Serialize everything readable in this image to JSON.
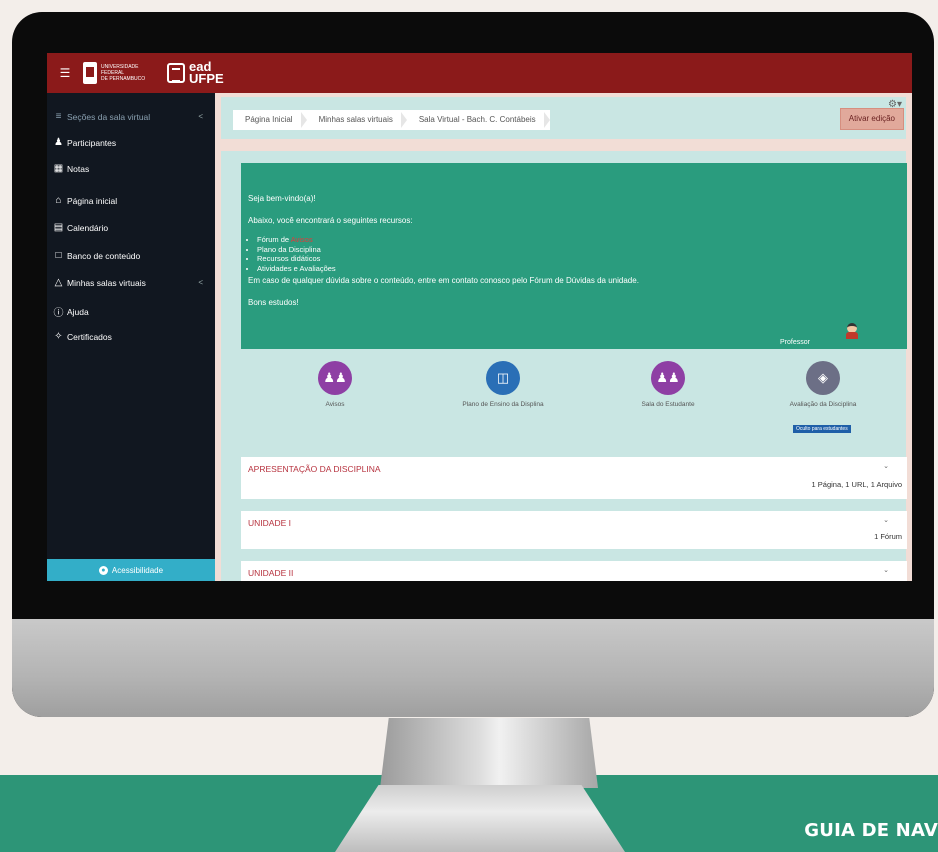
{
  "topbar": {
    "menu_icon": "hamburger-icon",
    "univ_text": [
      "UNIVERSIDADE",
      "FEDERAL",
      "DE PERNAMBUCO"
    ],
    "ead": "ead",
    "ufpe": "UFPE"
  },
  "sidebar": {
    "items": [
      {
        "icon": "list-icon",
        "label": "Seções da sala virtual",
        "chevron": true,
        "dim": true
      },
      {
        "icon": "participants-icon",
        "label": "Participantes"
      },
      {
        "icon": "grades-icon",
        "label": "Notas"
      },
      {
        "icon": "home-icon",
        "label": "Página inicial"
      },
      {
        "icon": "calendar-icon",
        "label": "Calendário"
      },
      {
        "icon": "file-icon",
        "label": "Banco de conteúdo"
      },
      {
        "icon": "graduation-cap-icon",
        "label": "Minhas salas virtuais",
        "chevron": true
      },
      {
        "icon": "help-icon",
        "label": "Ajuda"
      },
      {
        "icon": "certificate-icon",
        "label": "Certificados"
      }
    ],
    "accessibility": "Acessibilidade"
  },
  "header": {
    "breadcrumbs": [
      "Página Inicial",
      "Minhas salas virtuais",
      "Sala Virtual - Bach. C. Contábeis"
    ],
    "edit_button": "Ativar edição"
  },
  "welcome": {
    "greeting": "Seja bem-vindo(a)!",
    "intro": "Abaixo, você encontrará o seguintes recursos:",
    "bullets": [
      {
        "text": "Fórum de ",
        "highlight": "Avisos"
      },
      {
        "text": "Plano da Disciplina"
      },
      {
        "text": "Recursos didáticos"
      },
      {
        "text": "Atividades e Avaliações"
      }
    ],
    "contact": "Em caso de qualquer dúvida sobre o conteúdo, entre em contato conosco pelo Fórum de Dúvidas da unidade.",
    "closing": "Bons estudos!",
    "professor": "Professor"
  },
  "tiles": [
    {
      "label": "Avisos",
      "color": "#8e3fa4",
      "icon": "people-icon"
    },
    {
      "label": "Plano de Ensino da Displina",
      "color": "#2a6fb6",
      "icon": "browser-window-icon"
    },
    {
      "label": "Sala do Estudante",
      "color": "#8e3fa4",
      "icon": "people-icon"
    },
    {
      "label": "Avaliação da Disciplina",
      "color": "#6c6f86",
      "icon": "box-icon"
    }
  ],
  "hidden_badge": "Oculto para estudantes",
  "sections": [
    {
      "title": "APRESENTAÇÃO DA DISCIPLINA",
      "meta": "1 Página, 1 URL, 1 Arquivo"
    },
    {
      "title": "UNIDADE I",
      "meta": "1 Fórum"
    },
    {
      "title": "UNIDADE II",
      "meta": ""
    }
  ],
  "footer": "GUIA DE NAV"
}
